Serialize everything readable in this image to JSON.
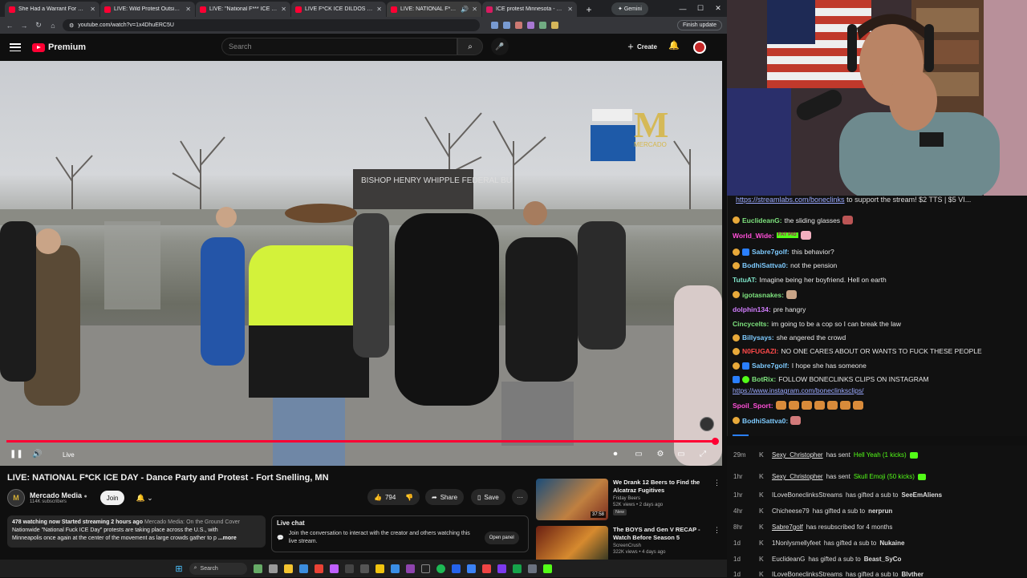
{
  "browser": {
    "tabs": [
      {
        "title": "She Had a Warrant For Obstru"
      },
      {
        "title": "LIVE: Wild Protest Outside Bro"
      },
      {
        "title": "LIVE: \"National F*** ICE Day\" Pr"
      },
      {
        "title": "LIVE F*CK ICE DILDOS Protest"
      },
      {
        "title": "LIVE: NATIONAL F*CK ICE D"
      },
      {
        "title": "ICE protest Minnesota - YouTu"
      }
    ],
    "gemini_label": "Gemini",
    "url": "youtube.com/watch?v=1x4DhuERC5U",
    "finish_update": "Finish update"
  },
  "youtube": {
    "logo_label": "Premium",
    "search_placeholder": "Search",
    "create_label": "Create",
    "live_label": "Live",
    "video_title": "LIVE: NATIONAL F*CK ICE DAY - Dance Party and Protest - Fort Snelling, MN",
    "channel_name": "Mercado Media",
    "channel_subs": "114K subscribers",
    "join_label": "Join",
    "likes": "794",
    "share_label": "Share",
    "save_label": "Save",
    "description": {
      "stats": "478 watching now  Started streaming 2 hours ago",
      "channel_tag": "Mercado Media: On the Ground Cover",
      "line1": "Nationwide \"National Fuck ICE Day\" protests are taking place across the U.S., with",
      "line2": "Minneapolis once again at the center of the movement as large crowds gather to p",
      "more": "...more"
    },
    "live_chat": {
      "heading": "Live chat",
      "text": "Join the conversation to interact with the creator and others watching this live stream.",
      "open_panel": "Open panel"
    },
    "recommendations": [
      {
        "title": "We Drank 12 Beers to Find the Alcatraz Fugitives",
        "channel": "Friday Beers",
        "meta": "52K views • 2 days ago",
        "badge": "New",
        "duration": "37:58"
      },
      {
        "title": "The BOYS and Gen V RECAP - Watch Before Season 5",
        "channel": "ScreenCrush",
        "meta": "322K views • 4 days ago",
        "badge": "",
        "duration": ""
      }
    ],
    "video_sign_text": "BISHOP HENRY WHIPPLE FEDERAL BU",
    "watermark_text": "MERCADO"
  },
  "taskbar": {
    "search_label": "Search"
  },
  "stream_chat": {
    "banner_link": "https://streamlabs.com/boneclinks",
    "banner_text": " to support the stream! $2 TTS | $5 VI...",
    "messages": [
      {
        "user": "EuclideanG:",
        "text": "the sliding glasses",
        "user_color": "#7ee37e"
      },
      {
        "user": "World_Wide:",
        "text": "",
        "user_color": "#ff4fd8"
      },
      {
        "user": "Sabre7golf:",
        "text": "this behavior?",
        "user_color": "#7ecbff"
      },
      {
        "user": "BodhiSattva0:",
        "text": "not the pension",
        "user_color": "#7ecbff"
      },
      {
        "user": "TutuAT:",
        "text": "Imagine being her boyfriend. Hell on earth",
        "user_color": "#7ee3c8"
      },
      {
        "user": "igotasnakes:",
        "text": "",
        "user_color": "#7ee37e"
      },
      {
        "user": "dolphin134:",
        "text": "pre hangry",
        "user_color": "#d27eff"
      },
      {
        "user": "Cincycelts:",
        "text": "im going to be a cop so I can break the law",
        "user_color": "#7ee37e"
      },
      {
        "user": "Billysays:",
        "text": "she angered the crowd",
        "user_color": "#7ecbff"
      },
      {
        "user": "N0FUGAZI:",
        "text": "NO ONE CARES ABOUT  OR WANTS TO FUCK  THESE PEOPLE",
        "user_color": "#ff4a4a"
      },
      {
        "user": "Sabre7golf:",
        "text": "I hope she has someone",
        "user_color": "#7ecbff"
      },
      {
        "user": "BotRix:",
        "text": "FOLLOW BONECLINKS CLIPS ON INSTAGRAM",
        "user_color": "#7ee37e"
      },
      {
        "user": "",
        "text": "https://www.instagram.com/boneclinksclips/",
        "user_color": "#9aa9ff"
      },
      {
        "user": "Spoil_Sport:",
        "text": "",
        "user_color": "#ff4fd8"
      },
      {
        "user": "BodhiSattva0:",
        "text": "",
        "user_color": "#7ecbff"
      }
    ],
    "emote_label": "FAT PIG"
  },
  "events": [
    {
      "time": "29m",
      "name": "Sexy_Christopher",
      "action": "has sent",
      "item": "Hell Yeah (1 kicks)",
      "target": "",
      "underline": true
    },
    {
      "time": "1hr",
      "name": "Sexy_Christopher",
      "action": "has sent",
      "item": "Skull Emoji (50 kicks)",
      "target": "",
      "underline": true
    },
    {
      "time": "1hr",
      "name": "ILoveBoneclinksStreams",
      "action": "has gifted a sub to",
      "item": "",
      "target": "SeeEmAliens",
      "underline": false
    },
    {
      "time": "4hr",
      "name": "Chicheese79",
      "action": "has gifted a sub to",
      "item": "",
      "target": "nerprun",
      "underline": false
    },
    {
      "time": "8hr",
      "name": "Sabre7golf",
      "action": "has resubscribed for 4 months",
      "item": "",
      "target": "",
      "underline": true
    },
    {
      "time": "1d",
      "name": "1Nonlysmellyfeet",
      "action": "has gifted a sub to",
      "item": "",
      "target": "Nukaine",
      "underline": false
    },
    {
      "time": "1d",
      "name": "EuclideanG",
      "action": "has gifted a sub to",
      "item": "",
      "target": "Beast_SyCo",
      "underline": false
    },
    {
      "time": "1d",
      "name": "ILoveBoneclinksStreams",
      "action": "has gifted a sub to",
      "item": "",
      "target": "Blvther",
      "underline": false
    }
  ]
}
